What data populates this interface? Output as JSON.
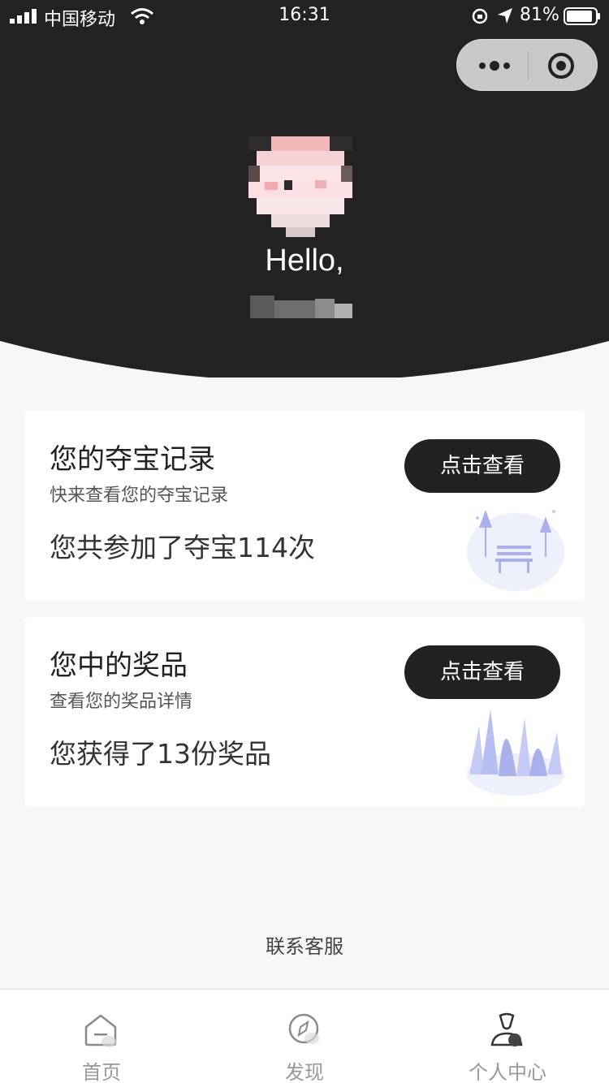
{
  "status_bar": {
    "carrier": "中国移动",
    "time": "16:31",
    "battery": "81%"
  },
  "header": {
    "greeting": "Hello,"
  },
  "cards": [
    {
      "title": "您的夺宝记录",
      "subtitle": "快来查看您的夺宝记录",
      "stat": "您共参加了夺宝114次",
      "button": "点击查看",
      "illustration": "park-bench-illustration"
    },
    {
      "title": "您中的奖品",
      "subtitle": "查看您的奖品详情",
      "stat": "您获得了13份奖品",
      "button": "点击查看",
      "illustration": "grass-illustration"
    }
  ],
  "contact": "联系客服",
  "tabbar": {
    "items": [
      {
        "label": "首页",
        "icon": "home-icon",
        "active": false
      },
      {
        "label": "发现",
        "icon": "compass-icon",
        "active": false
      },
      {
        "label": "个人中心",
        "icon": "user-icon",
        "active": true
      }
    ]
  },
  "colors": {
    "header_bg": "#222222",
    "button_bg": "#222222",
    "illustration": "#a9b0ec",
    "page_bg": "#f7f7f7"
  }
}
